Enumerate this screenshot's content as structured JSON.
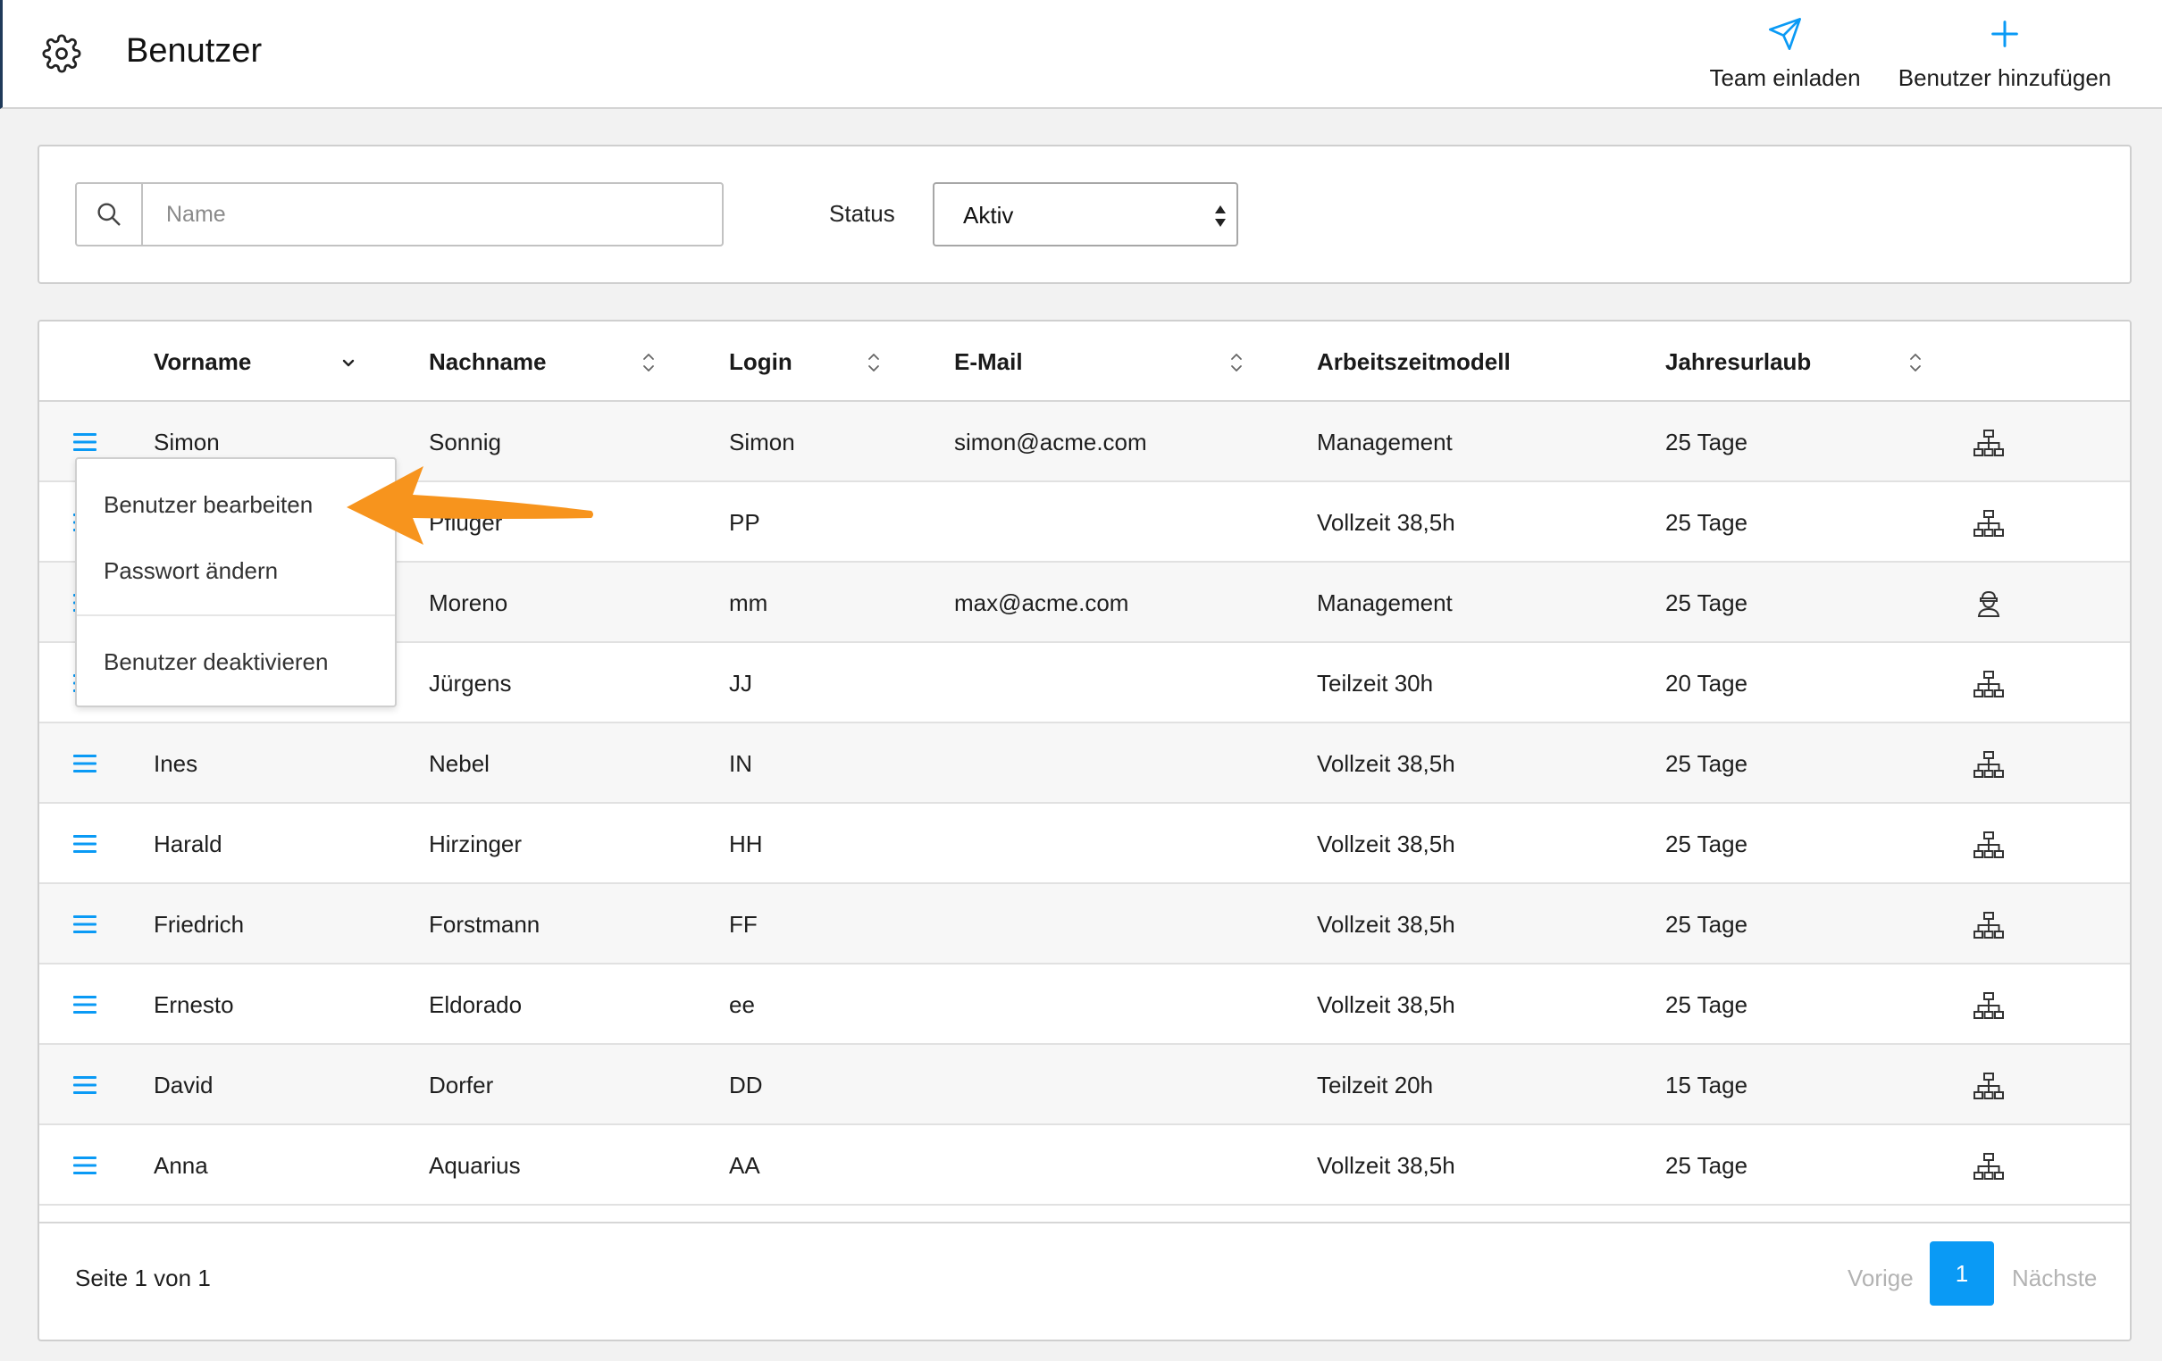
{
  "header": {
    "title": "Benutzer",
    "invite_label": "Team einladen",
    "add_label": "Benutzer hinzufügen"
  },
  "filter": {
    "search_placeholder": "Name",
    "status_label": "Status",
    "status_value": "Aktiv"
  },
  "table": {
    "columns": [
      "Vorname",
      "Nachname",
      "Login",
      "E-Mail",
      "Arbeitszeitmodell",
      "Jahresurlaub"
    ],
    "rows": [
      {
        "first": "Simon",
        "last": "Sonnig",
        "login": "Simon",
        "email": "simon@acme.com",
        "model": "Management",
        "vacation": "25 Tage",
        "icon": "org-chart-icon"
      },
      {
        "first": "",
        "last": "Pfluger",
        "login": "PP",
        "email": "",
        "model": "Vollzeit 38,5h",
        "vacation": "25 Tage",
        "icon": "org-chart-icon"
      },
      {
        "first": "",
        "last": "Moreno",
        "login": "mm",
        "email": "max@acme.com",
        "model": "Management",
        "vacation": "25 Tage",
        "icon": "user-badge-icon"
      },
      {
        "first": "",
        "last": "Jürgens",
        "login": "JJ",
        "email": "",
        "model": "Teilzeit 30h",
        "vacation": "20 Tage",
        "icon": "org-chart-icon"
      },
      {
        "first": "Ines",
        "last": "Nebel",
        "login": "IN",
        "email": "",
        "model": "Vollzeit 38,5h",
        "vacation": "25 Tage",
        "icon": "org-chart-icon"
      },
      {
        "first": "Harald",
        "last": "Hirzinger",
        "login": "HH",
        "email": "",
        "model": "Vollzeit 38,5h",
        "vacation": "25 Tage",
        "icon": "org-chart-icon"
      },
      {
        "first": "Friedrich",
        "last": "Forstmann",
        "login": "FF",
        "email": "",
        "model": "Vollzeit 38,5h",
        "vacation": "25 Tage",
        "icon": "org-chart-icon"
      },
      {
        "first": "Ernesto",
        "last": "Eldorado",
        "login": "ee",
        "email": "",
        "model": "Vollzeit 38,5h",
        "vacation": "25 Tage",
        "icon": "org-chart-icon"
      },
      {
        "first": "David",
        "last": "Dorfer",
        "login": "DD",
        "email": "",
        "model": "Teilzeit 20h",
        "vacation": "15 Tage",
        "icon": "org-chart-icon"
      },
      {
        "first": "Anna",
        "last": "Aquarius",
        "login": "AA",
        "email": "",
        "model": "Vollzeit 38,5h",
        "vacation": "25 Tage",
        "icon": "org-chart-icon"
      }
    ]
  },
  "context_menu": {
    "items": [
      "Benutzer bearbeiten",
      "Passwort ändern",
      "Benutzer deaktivieren"
    ]
  },
  "pagination": {
    "info": "Seite 1 von 1",
    "prev": "Vorige",
    "current": "1",
    "next": "Nächste"
  },
  "colors": {
    "accent": "#0a9af5",
    "annotation_arrow": "#f7941d"
  }
}
